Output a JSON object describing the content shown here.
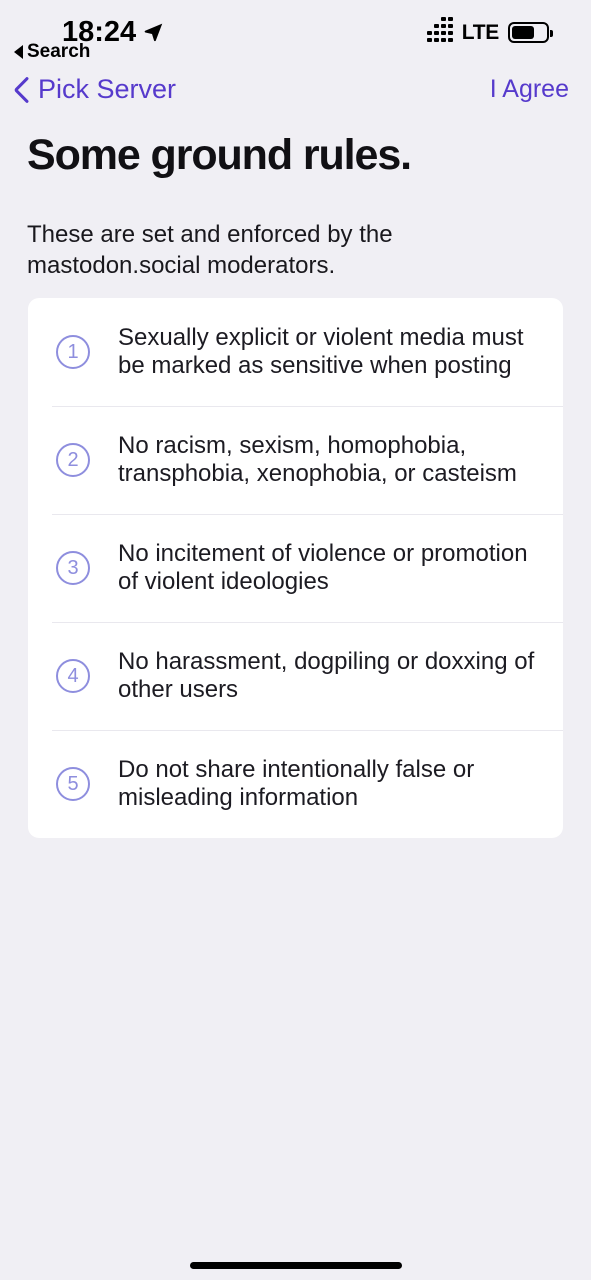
{
  "status_bar": {
    "time": "18:24",
    "location_arrow_icon": "location-arrow-icon",
    "back_to_app": {
      "triangle_icon": "left-triangle-icon",
      "label": "Search"
    },
    "signal_icon": "cellular-signal-dots-icon",
    "signal_bars": 4,
    "network_type": "LTE",
    "battery_icon": "battery-icon",
    "battery_level_percent": 60
  },
  "nav_bar": {
    "back_chevron_icon": "chevron-left-icon",
    "back_label": "Pick Server",
    "action_label": "I Agree"
  },
  "header": {
    "title": "Some ground rules.",
    "subtitle": "These are set and enforced by the mastodon.social moderators."
  },
  "rules": [
    {
      "number": "1",
      "text": "Sexually explicit or violent media must be marked as sensitive when posting"
    },
    {
      "number": "2",
      "text": "No racism, sexism, homophobia, transphobia, xenophobia, or casteism"
    },
    {
      "number": "3",
      "text": "No incitement of violence or promotion of violent ideologies"
    },
    {
      "number": "4",
      "text": "No harassment, dogpiling or doxxing of other users"
    },
    {
      "number": "5",
      "text": "Do not share intentionally false or misleading information"
    }
  ],
  "colors": {
    "accent": "#563ACC",
    "badge": "#8E8EDE",
    "page_background": "#F0EFF4",
    "card_background": "#FFFFFF",
    "text": "#1C1B22"
  },
  "home_indicator": "home-indicator"
}
